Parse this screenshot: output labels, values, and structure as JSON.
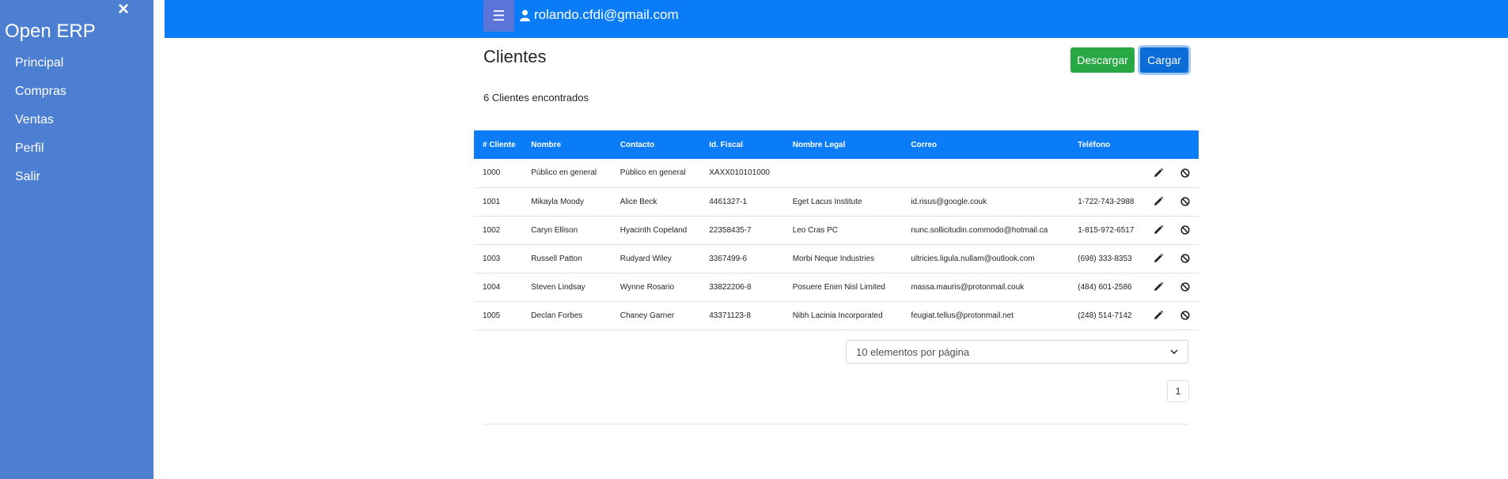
{
  "sidebar": {
    "brand": "Open ERP",
    "close_glyph": "×",
    "items": [
      {
        "label": "Principal"
      },
      {
        "label": "Compras"
      },
      {
        "label": "Ventas"
      },
      {
        "label": "Perfil"
      },
      {
        "label": "Salir"
      }
    ]
  },
  "topbar": {
    "menu_glyph": "☰",
    "user_email": "rolando.cfdi@gmail.com"
  },
  "page": {
    "title": "Clientes",
    "download_label": "Descargar",
    "upload_label": "Cargar",
    "count_text": "6 Clientes encontrados"
  },
  "table": {
    "headers": [
      "# Cliente",
      "Nombre",
      "Contacto",
      "Id. Fiscal",
      "Nombre Legal",
      "Correo",
      "Teléfono"
    ],
    "rows": [
      [
        "1000",
        "Público en general",
        "Público en general",
        "XAXX010101000",
        "",
        "",
        ""
      ],
      [
        "1001",
        "Mikayla Moody",
        "Alice Beck",
        "4461327-1",
        "Eget Lacus Institute",
        "id.risus@google.couk",
        "1-722-743-2988"
      ],
      [
        "1002",
        "Caryn Ellison",
        "Hyacinth Copeland",
        "22358435-7",
        "Leo Cras PC",
        "nunc.sollicitudin.commodo@hotmail.ca",
        "1-815-972-6517"
      ],
      [
        "1003",
        "Russell Patton",
        "Rudyard Wiley",
        "3367499-6",
        "Morbi Neque Industries",
        "ultricies.ligula.nullam@outlook.com",
        "(698) 333-8353"
      ],
      [
        "1004",
        "Steven Lindsay",
        "Wynne Rosario",
        "33822206-8",
        "Posuere Enim Nisl Limited",
        "massa.mauris@protonmail.couk",
        "(484) 601-2586"
      ],
      [
        "1005",
        "Declan Forbes",
        "Chaney Garner",
        "43371123-8",
        "Nibh Lacinia Incorporated",
        "feugiat.tellus@protonmail.net",
        "(248) 514-7142"
      ]
    ],
    "row_actions": [
      "pencil-icon",
      "ban-icon"
    ]
  },
  "pagination": {
    "per_page_selected": "10 elementos por página",
    "current_page": "1"
  },
  "colors": {
    "sidebar": "#4c7fd1",
    "topbar": "#0a7cf7",
    "download": "#28a745",
    "upload": "#0b6bd7"
  }
}
